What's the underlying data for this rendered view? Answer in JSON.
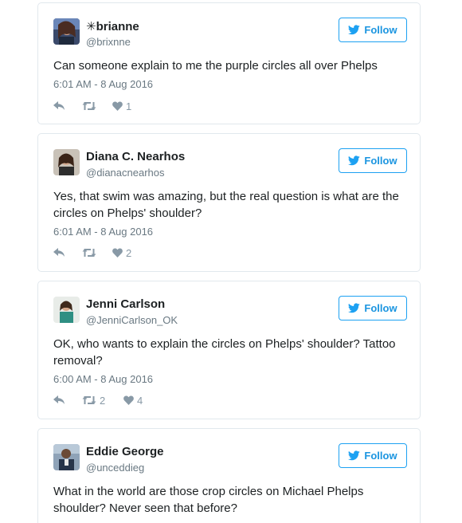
{
  "colors": {
    "accent": "#1da1f2",
    "text": "#1c2022",
    "meta": "#697882",
    "icon": "#8899a6",
    "border": "#e1e8ed"
  },
  "tweets": [
    {
      "name": "✳brianne",
      "handle": "@brixnne",
      "follow_label": "Follow",
      "text": "Can someone explain to me the purple circles all over Phelps",
      "time": "6:01 AM - 8 Aug 2016",
      "retweets": "",
      "likes": "1",
      "reply_icon": "reply-icon",
      "retweet_icon": "retweet-icon",
      "like_icon": "heart-icon"
    },
    {
      "name": "Diana C. Nearhos",
      "handle": "@dianacnearhos",
      "follow_label": "Follow",
      "text": "Yes, that swim was amazing, but the real question is what are the circles on Phelps' shoulder?",
      "time": "6:01 AM - 8 Aug 2016",
      "retweets": "",
      "likes": "2",
      "reply_icon": "reply-icon",
      "retweet_icon": "retweet-icon",
      "like_icon": "heart-icon"
    },
    {
      "name": "Jenni Carlson",
      "handle": "@JenniCarlson_OK",
      "follow_label": "Follow",
      "text": "OK, who wants to explain the circles on Phelps' shoulder? Tattoo removal?",
      "time": "6:00 AM - 8 Aug 2016",
      "retweets": "2",
      "likes": "4",
      "reply_icon": "reply-icon",
      "retweet_icon": "retweet-icon",
      "like_icon": "heart-icon"
    },
    {
      "name": "Eddie George",
      "handle": "@unceddieg",
      "follow_label": "Follow",
      "text": "What in the world are those crop circles on Michael Phelps shoulder? Never seen that before?",
      "time": "",
      "retweets": "",
      "likes": "",
      "reply_icon": "reply-icon",
      "retweet_icon": "retweet-icon",
      "like_icon": "heart-icon"
    }
  ]
}
